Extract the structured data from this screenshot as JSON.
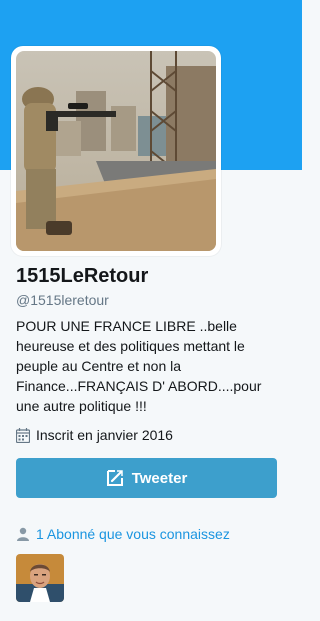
{
  "profile": {
    "name": "1515LeRetour",
    "handle": "@1515leretour",
    "bio": "POUR UNE FRANCE LIBRE ..belle heureuse et des politiques mettant le peuple au Centre et non la Finance...FRANÇAIS D' ABORD....pour une autre politique !!!",
    "joined": "Inscrit en janvier 2016"
  },
  "actions": {
    "tweet_label": "Tweeter"
  },
  "followers": {
    "known_label": "1 Abonné que vous connaissez"
  },
  "colors": {
    "banner": "#1da1f2",
    "button": "#3d9fcc",
    "link": "#1b95e0"
  },
  "icons": [
    "calendar-icon",
    "compose-tweet-icon",
    "person-icon"
  ]
}
